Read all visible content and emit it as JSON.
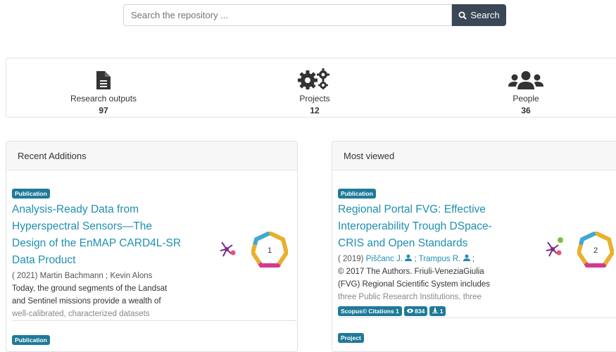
{
  "search": {
    "placeholder": "Search the repository ...",
    "button_label": "Search"
  },
  "stats": [
    {
      "label": "Research outputs",
      "count": "97",
      "icon": "document-icon"
    },
    {
      "label": "Projects",
      "count": "12",
      "icon": "gears-icon"
    },
    {
      "label": "People",
      "count": "36",
      "icon": "users-icon"
    }
  ],
  "recent": {
    "header": "Recent Additions",
    "item": {
      "badge": "Publication",
      "title_lines": [
        "Analysis-Ready Data from",
        "Hyperspectral Sensors—The",
        "Design of the EnMAP CARD4L-SR",
        "Data Product"
      ],
      "meta": "( 2021) Martin Bachmann ; Kevin Alons",
      "abstract_lines": [
        "Today, the ground segments of the Landsat",
        "and Sentinel missions provide a wealth of",
        "well-calibrated, characterized datasets"
      ],
      "altmetric_score": "1"
    },
    "next_badge": "Publication"
  },
  "viewed": {
    "header": "Most viewed",
    "item": {
      "badge": "Publication",
      "title_lines": [
        "Regional Portal FVG: Effective",
        "Interoperability Trough DSpace-",
        "CRIS and Open Standards"
      ],
      "meta_year": "( 2019)",
      "author1": "Piščanc J.",
      "author2": "Trampus R.",
      "abstract_lines": [
        "© 2017 The Authors. Friuli-VeneziaGiulia",
        "(FVG) Regional Scientific System includes",
        "three Public Research Institutions, three"
      ],
      "scopus": "Scopus© Citations 1",
      "views": "834",
      "downloads": "1",
      "altmetric_score": "2"
    },
    "next_badge": "Project"
  },
  "colors": {
    "accent": "#1f8fb0",
    "badge": "#1f7a99",
    "button": "#3a4756"
  }
}
